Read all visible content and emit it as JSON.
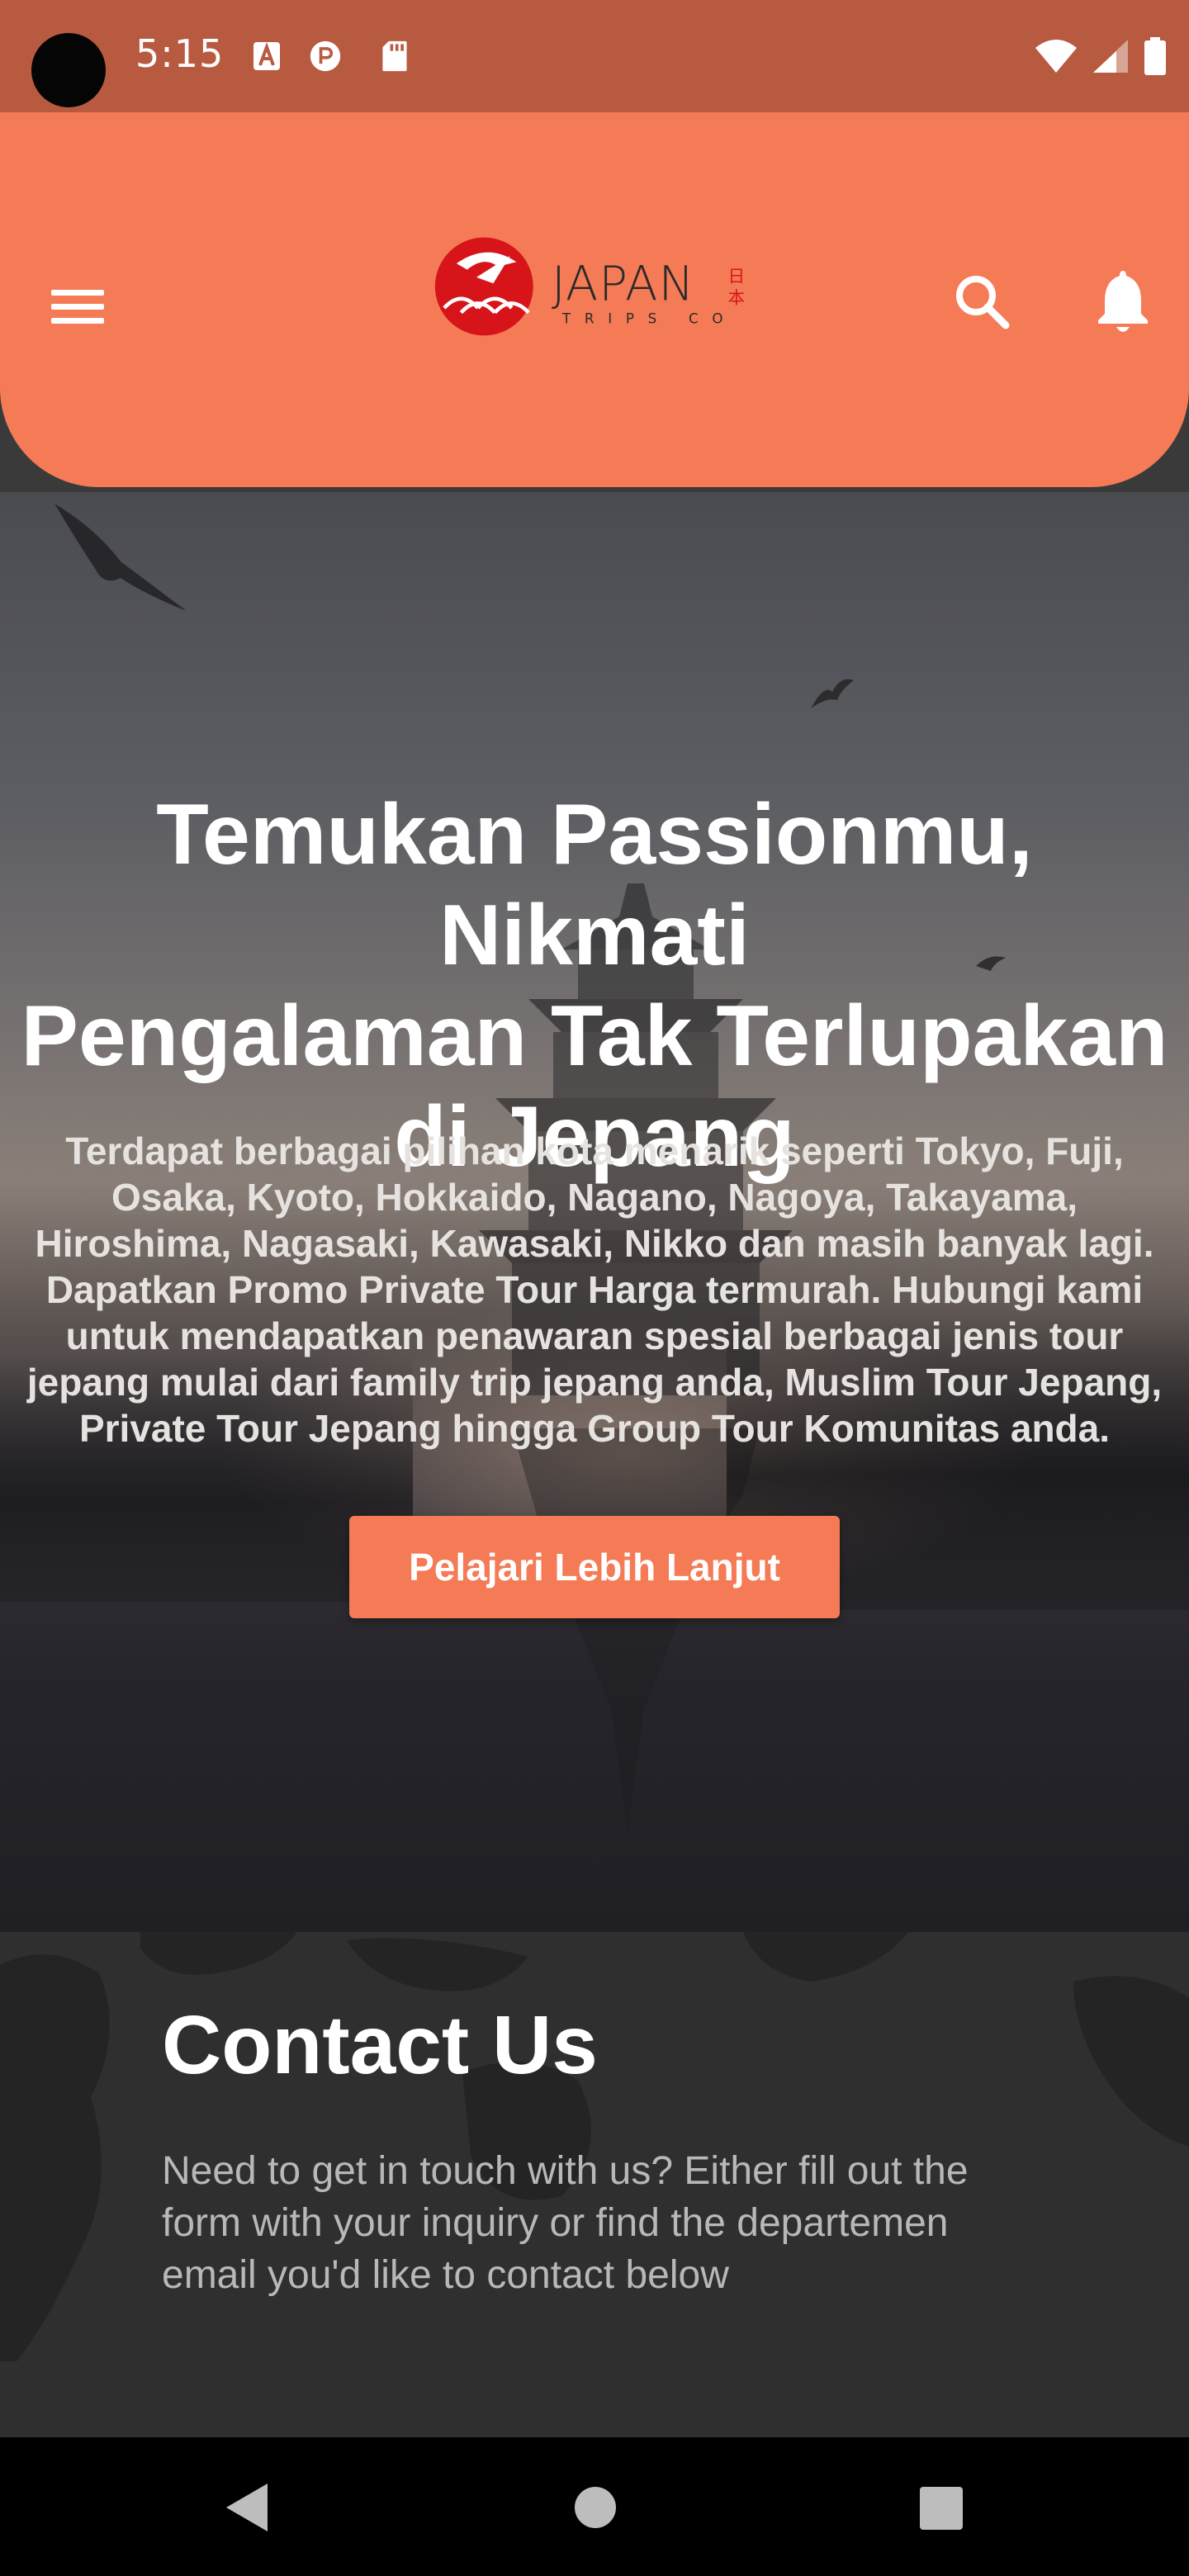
{
  "status_bar": {
    "time": "5:15",
    "left_icons": [
      "a-icon",
      "p-circle-icon",
      "sd-card-icon"
    ],
    "right_icons": [
      "wifi-icon",
      "signal-icon",
      "battery-icon"
    ]
  },
  "header": {
    "logo_text": "JAPAN",
    "logo_sub": "TRIPS CO",
    "logo_kanji": "日本",
    "accent_color": "#f47b56"
  },
  "hero": {
    "title_lines": [
      "Temukan Passionmu, Nikmati",
      "Pengalaman Tak Terlupakan",
      "di Jepang"
    ],
    "description": "Terdapat berbagai pilihan kota menarik seperti Tokyo, Fuji, Osaka, Kyoto, Hokkaido, Nagano, Nagoya, Takayama, Hiroshima, Nagasaki, Kawasaki, Nikko dan masih banyak lagi. Dapatkan Promo Private Tour Harga termurah. Hubungi kami untuk mendapatkan penawaran spesial berbagai jenis tour jepang mulai dari family trip jepang anda, Muslim Tour Jepang, Private Tour Jepang hingga Group Tour Komunitas anda.",
    "cta_label": "Pelajari Lebih Lanjut"
  },
  "contact": {
    "title": "Contact Us",
    "description": "Need to get in touch with us? Either fill out the form with your inquiry or find the departemen email you'd like to contact below"
  },
  "nav_bar": {
    "icons": [
      "back-icon",
      "home-icon",
      "recents-icon"
    ]
  }
}
